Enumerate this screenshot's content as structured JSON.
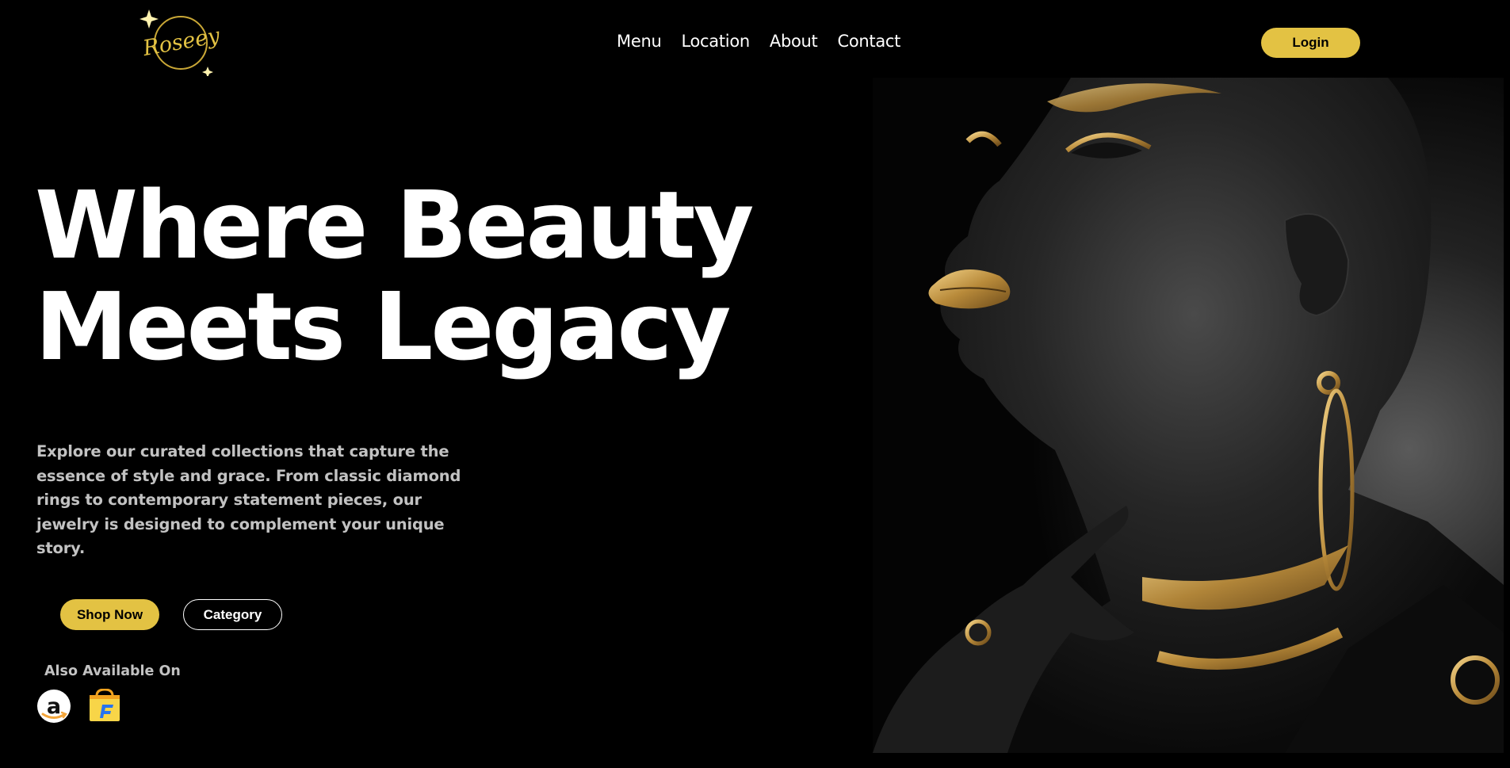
{
  "brand": {
    "logo_text": "Roseey",
    "accent_color": "#e3c243"
  },
  "nav": {
    "items": [
      {
        "label": "Menu"
      },
      {
        "label": "Location"
      },
      {
        "label": "About"
      },
      {
        "label": "Contact"
      }
    ],
    "login_label": "Login"
  },
  "hero": {
    "title_line1": "Where Beauty",
    "title_line2": "Meets Legacy",
    "description": "Explore our curated collections that capture the essence of style and grace. From classic diamond rings to contemporary statement pieces, our jewelry is designed to complement your unique story.",
    "shop_label": "Shop Now",
    "category_label": "Category",
    "available_label": "Also Available On"
  },
  "marketplaces": [
    {
      "icon": "amazon-icon"
    },
    {
      "icon": "flipkart-icon"
    }
  ],
  "image": {
    "subject": "portrait-with-gold-jewelry"
  }
}
